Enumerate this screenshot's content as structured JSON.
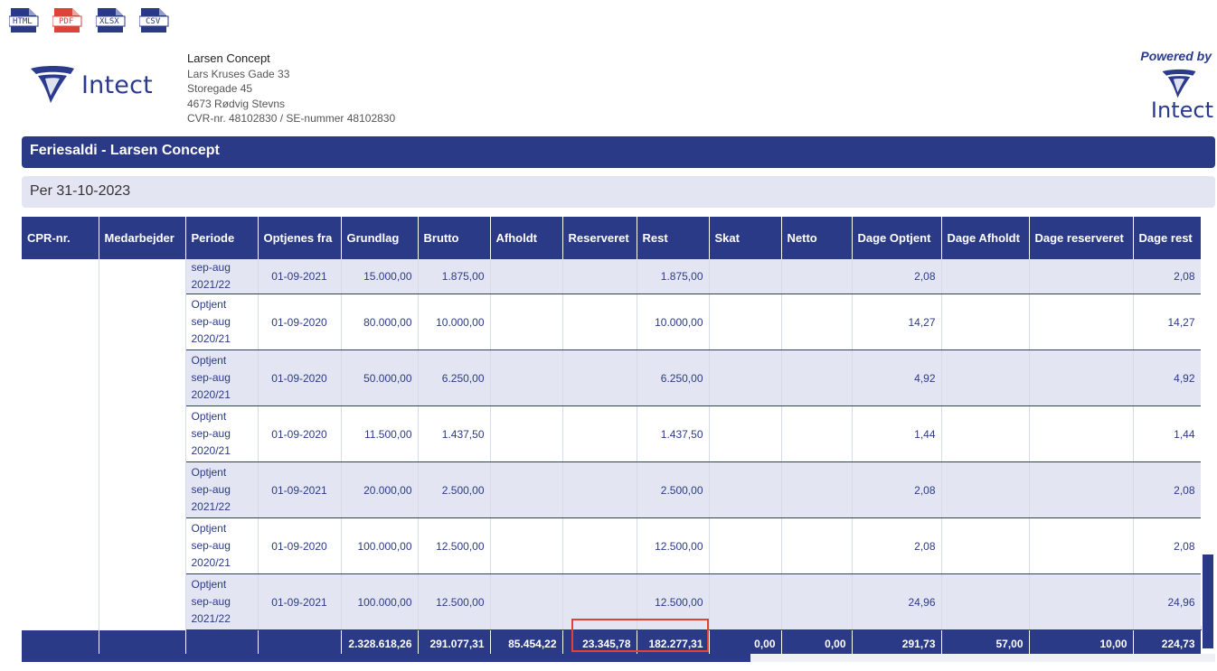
{
  "exports": [
    {
      "label": "HTML",
      "color": "#2b3a87"
    },
    {
      "label": "PDF",
      "color": "#e0423a"
    },
    {
      "label": "XLSX",
      "color": "#2b3a87"
    },
    {
      "label": "CSV",
      "color": "#2b3a87"
    }
  ],
  "logo": {
    "text": "Intect"
  },
  "company": {
    "name": "Larsen Concept",
    "address1": "Lars Kruses Gade 33",
    "address2": "Storegade 45",
    "city": "4673 Rødvig Stevns",
    "ids": "CVR-nr. 48102830 / SE-nummer 48102830"
  },
  "powered": {
    "label": "Powered by",
    "logo_text": "Intect"
  },
  "report": {
    "title": "Feriesaldi - Larsen Concept",
    "subtitle": "Per 31-10-2023"
  },
  "columns": [
    "CPR-nr.",
    "Medarbejder",
    "Periode",
    "Optjenes fra",
    "Grundlag",
    "Brutto",
    "Afholdt",
    "Reserveret",
    "Rest",
    "Skat",
    "Netto",
    "Dage Optjent",
    "Dage Afholdt",
    "Dage reserveret",
    "Dage rest"
  ],
  "rows": [
    {
      "period": [
        "sep-aug",
        "2021/22"
      ],
      "from": "01-09-2021",
      "grundlag": "15.000,00",
      "brutto": "1.875,00",
      "afholdt": "",
      "reserveret": "",
      "rest": "1.875,00",
      "skat": "",
      "netto": "",
      "dage_optjent": "2,08",
      "dage_afholdt": "",
      "dage_reserveret": "",
      "dage_rest": "2,08"
    },
    {
      "period": [
        "Optjent",
        "sep-aug",
        "2020/21"
      ],
      "from": "01-09-2020",
      "grundlag": "80.000,00",
      "brutto": "10.000,00",
      "afholdt": "",
      "reserveret": "",
      "rest": "10.000,00",
      "skat": "",
      "netto": "",
      "dage_optjent": "14,27",
      "dage_afholdt": "",
      "dage_reserveret": "",
      "dage_rest": "14,27"
    },
    {
      "period": [
        "Optjent",
        "sep-aug",
        "2020/21"
      ],
      "from": "01-09-2020",
      "grundlag": "50.000,00",
      "brutto": "6.250,00",
      "afholdt": "",
      "reserveret": "",
      "rest": "6.250,00",
      "skat": "",
      "netto": "",
      "dage_optjent": "4,92",
      "dage_afholdt": "",
      "dage_reserveret": "",
      "dage_rest": "4,92"
    },
    {
      "period": [
        "Optjent",
        "sep-aug",
        "2020/21"
      ],
      "from": "01-09-2020",
      "grundlag": "11.500,00",
      "brutto": "1.437,50",
      "afholdt": "",
      "reserveret": "",
      "rest": "1.437,50",
      "skat": "",
      "netto": "",
      "dage_optjent": "1,44",
      "dage_afholdt": "",
      "dage_reserveret": "",
      "dage_rest": "1,44"
    },
    {
      "period": [
        "Optjent",
        "sep-aug",
        "2021/22"
      ],
      "from": "01-09-2021",
      "grundlag": "20.000,00",
      "brutto": "2.500,00",
      "afholdt": "",
      "reserveret": "",
      "rest": "2.500,00",
      "skat": "",
      "netto": "",
      "dage_optjent": "2,08",
      "dage_afholdt": "",
      "dage_reserveret": "",
      "dage_rest": "2,08"
    },
    {
      "period": [
        "Optjent",
        "sep-aug",
        "2020/21"
      ],
      "from": "01-09-2020",
      "grundlag": "100.000,00",
      "brutto": "12.500,00",
      "afholdt": "",
      "reserveret": "",
      "rest": "12.500,00",
      "skat": "",
      "netto": "",
      "dage_optjent": "2,08",
      "dage_afholdt": "",
      "dage_reserveret": "",
      "dage_rest": "2,08"
    },
    {
      "period": [
        "Optjent",
        "sep-aug",
        "2021/22"
      ],
      "from": "01-09-2021",
      "grundlag": "100.000,00",
      "brutto": "12.500,00",
      "afholdt": "",
      "reserveret": "",
      "rest": "12.500,00",
      "skat": "",
      "netto": "",
      "dage_optjent": "24,96",
      "dage_afholdt": "",
      "dage_reserveret": "",
      "dage_rest": "24,96"
    }
  ],
  "totals": {
    "grundlag": "2.328.618,26",
    "brutto": "291.077,31",
    "afholdt": "85.454,22",
    "reserveret": "23.345,78",
    "rest": "182.277,31",
    "skat": "0,00",
    "netto": "0,00",
    "dage_optjent": "291,73",
    "dage_afholdt": "57,00",
    "dage_reserveret": "10,00",
    "dage_rest": "224,73"
  }
}
